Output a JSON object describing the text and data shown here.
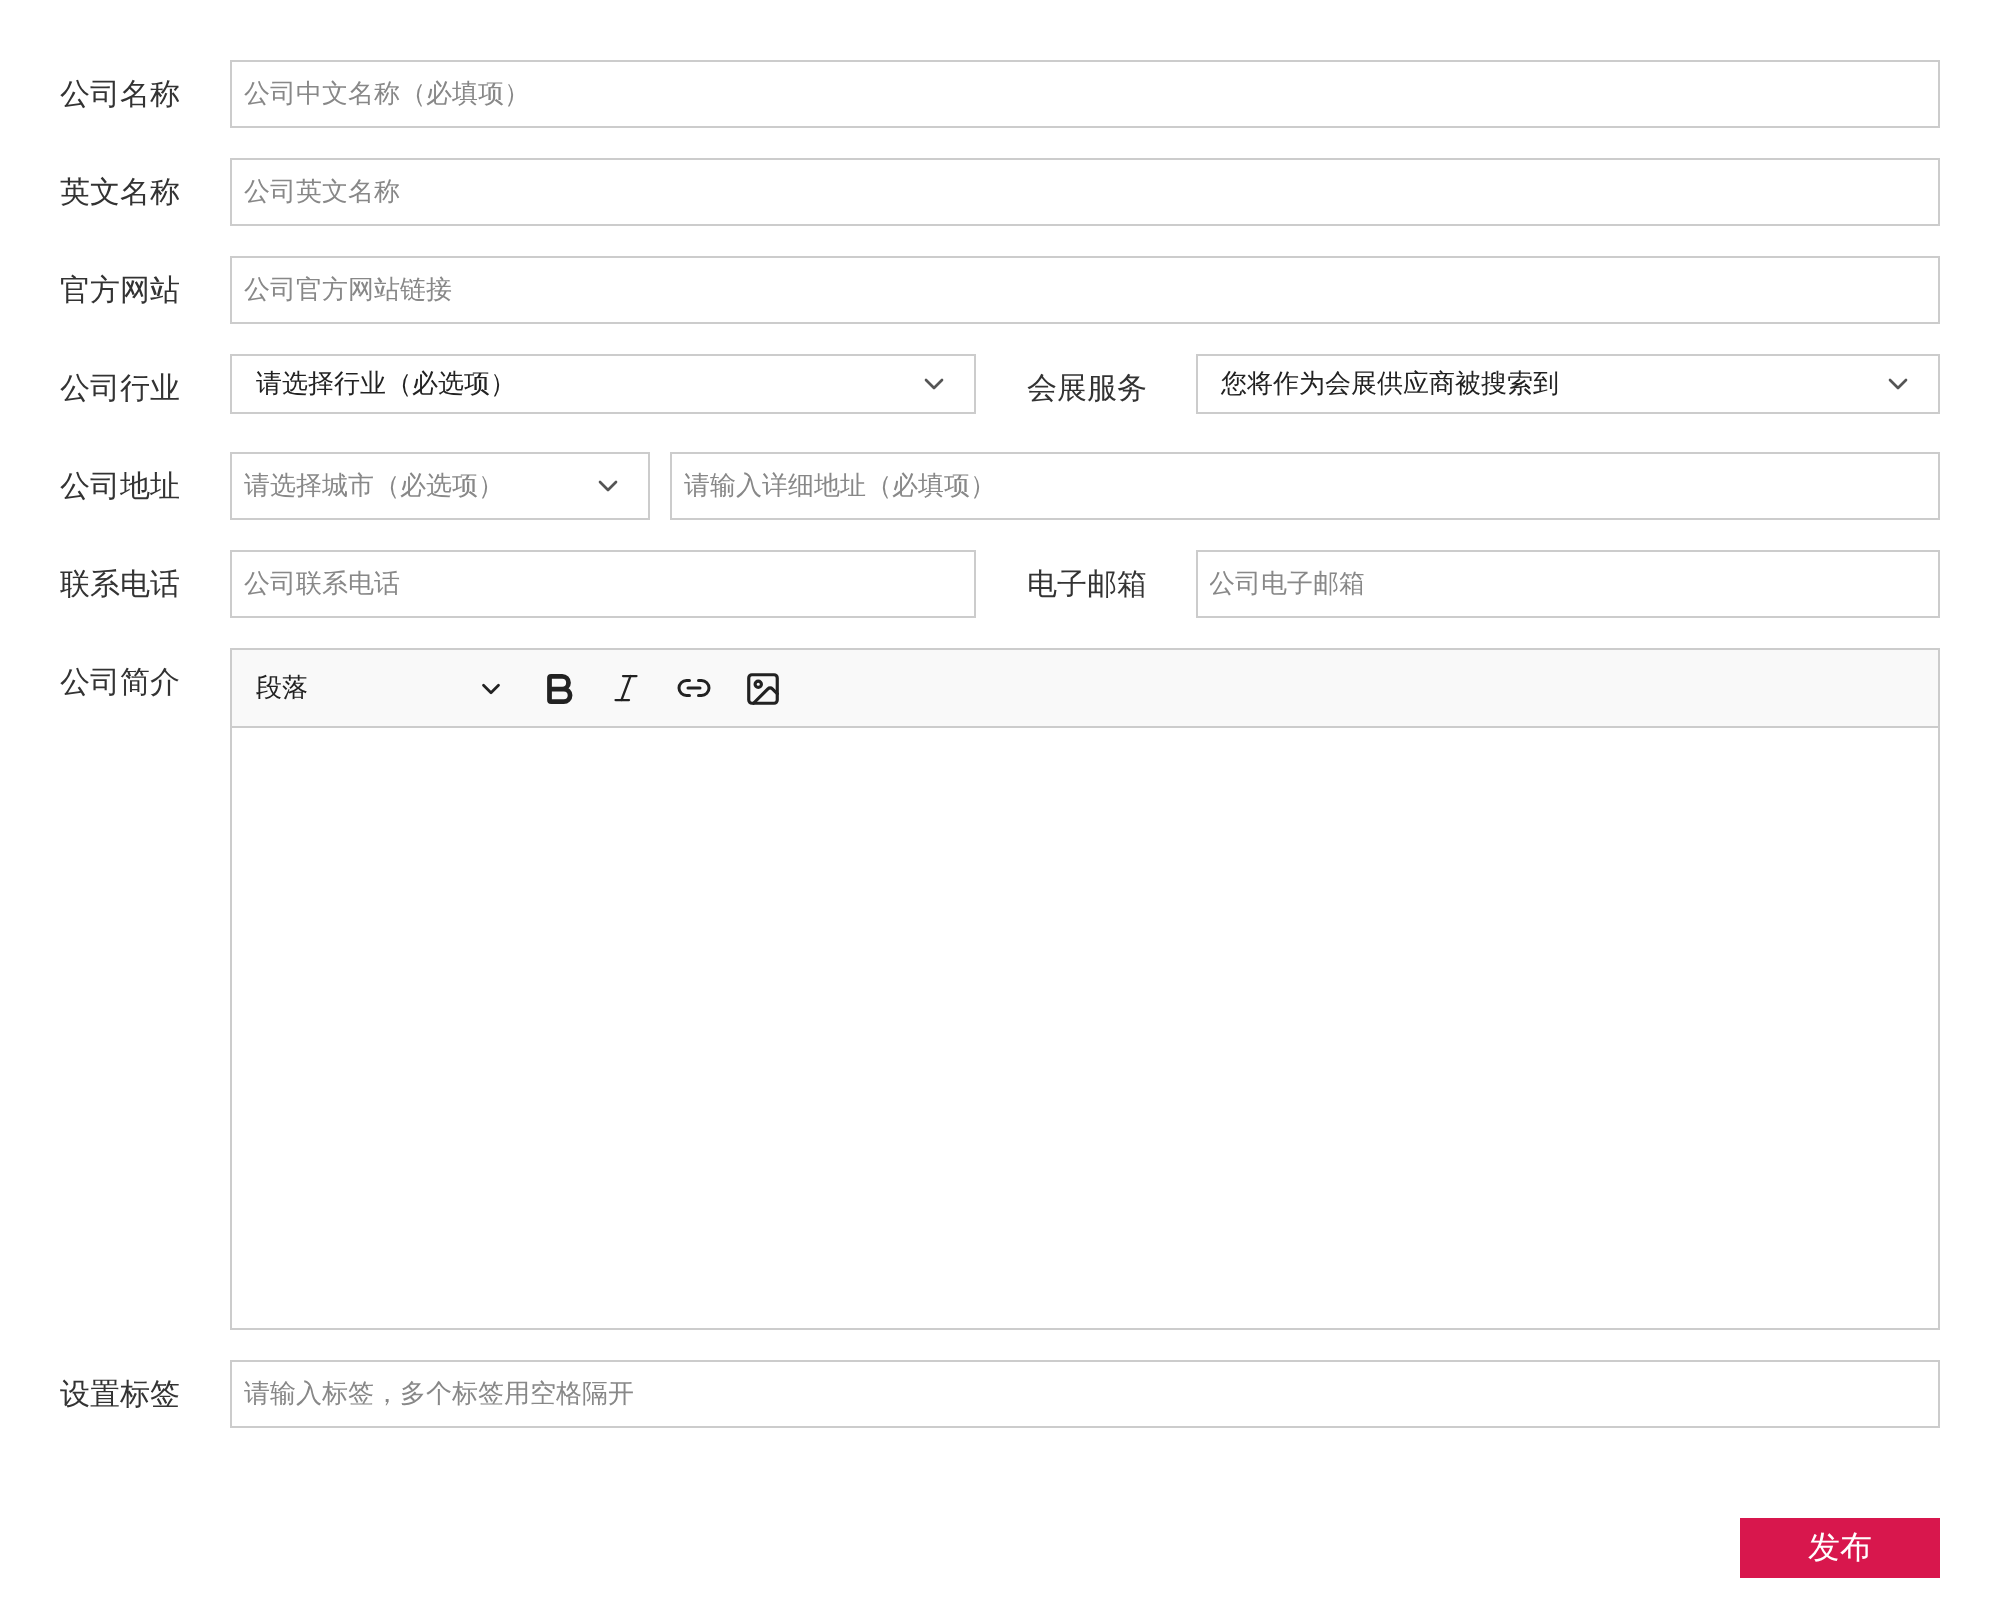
{
  "form": {
    "rows": [
      {
        "label": "公司名称",
        "fields": [
          {
            "kind": "input",
            "placeholder": "公司中文名称（必填项）"
          }
        ]
      },
      {
        "label": "英文名称",
        "fields": [
          {
            "kind": "input",
            "placeholder": "公司英文名称"
          }
        ]
      },
      {
        "label": "官方网站",
        "fields": [
          {
            "kind": "input",
            "placeholder": "公司官方网站链接"
          }
        ]
      },
      {
        "label": "公司行业",
        "fields": [
          {
            "kind": "select",
            "value": "请选择行业（必选项）"
          },
          {
            "kind": "label",
            "text": "会展服务"
          },
          {
            "kind": "select",
            "value": "您将作为会展供应商被搜索到"
          }
        ]
      },
      {
        "label": "公司地址",
        "fields": [
          {
            "kind": "select",
            "placeholder": "请选择城市（必选项）"
          },
          {
            "kind": "input",
            "placeholder": "请输入详细地址（必填项）"
          }
        ]
      },
      {
        "label": "联系电话",
        "fields": [
          {
            "kind": "input",
            "placeholder": "公司联系电话"
          },
          {
            "kind": "label",
            "text": "电子邮箱"
          },
          {
            "kind": "input",
            "placeholder": "公司电子邮箱"
          }
        ]
      },
      {
        "label": "公司简介",
        "fields": [
          {
            "kind": "editor",
            "format": "段落"
          }
        ]
      },
      {
        "label": "设置标签",
        "fields": [
          {
            "kind": "input",
            "placeholder": "请输入标签，多个标签用空格隔开"
          }
        ]
      }
    ],
    "submit": "发布"
  }
}
